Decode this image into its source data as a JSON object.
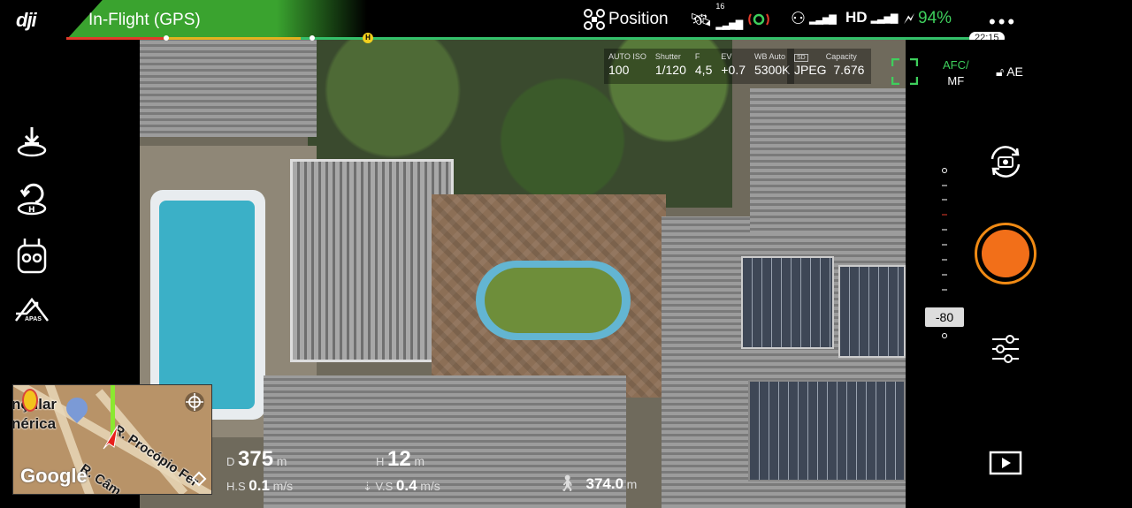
{
  "status_bar": {
    "logo": "dji",
    "flight_mode": "In-Flight (GPS)",
    "position_label": "Position",
    "gps_satellites": "16",
    "video_quality": "HD",
    "battery_percent": "94%",
    "time_remaining": "22:15",
    "home_marker": "H",
    "menu_icon": "more-dots-icon"
  },
  "camera_params": {
    "iso": {
      "label": "AUTO ISO",
      "value": "100"
    },
    "shutter": {
      "label": "Shutter",
      "value": "1/120"
    },
    "aperture": {
      "label": "F",
      "value": "4,5"
    },
    "ev": {
      "label": "EV",
      "value": "+0.7"
    },
    "wb": {
      "label": "WB Auto",
      "value": "5300K"
    },
    "format": {
      "label": "SD",
      "value": "JPEG"
    },
    "capacity": {
      "label": "Capacity",
      "value": "7.676"
    }
  },
  "focus": {
    "mode_top": "AFC/",
    "mode_bottom": "MF",
    "ae_label": "AE"
  },
  "left_rail": [
    "auto-takeoff-icon",
    "return-home-icon",
    "remote-controller-icon",
    "apas-icon"
  ],
  "apas_label": "APAS",
  "right_panel": {
    "gimbal_value": "-80",
    "icons": [
      "camera-switch-icon",
      "shutter-button",
      "camera-settings-icon",
      "playback-icon"
    ]
  },
  "map": {
    "labels": [
      "nçular",
      "nérica",
      "R. Procópio Fer",
      "R. Câm"
    ],
    "google": "Google"
  },
  "telemetry": {
    "d_label": "D",
    "d_value": "375",
    "d_unit": "m",
    "h_label": "H",
    "h_value": "12",
    "h_unit": "m",
    "hs_label": "H.S",
    "hs_value": "0.1",
    "hs_unit": "m/s",
    "vs_label": "V.S",
    "vs_value": "0.4",
    "vs_unit": "m/s",
    "alt_value": "374.0",
    "alt_unit": "m"
  },
  "colors": {
    "accent_green": "#3aa32f",
    "shutter_orange": "#f26f19",
    "focus_green": "#3ecf5c"
  }
}
